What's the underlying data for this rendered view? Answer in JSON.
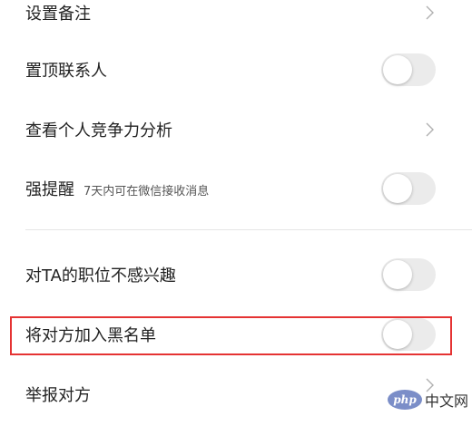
{
  "rows": {
    "remark": {
      "label": "设置备注"
    },
    "pin_contact": {
      "label": "置顶联系人",
      "toggle_on": false
    },
    "competitiveness": {
      "label": "查看个人竞争力分析"
    },
    "strong_reminder": {
      "label": "强提醒",
      "sublabel": "7天内可在微信接收消息",
      "toggle_on": false
    },
    "not_interested": {
      "label": "对TA的职位不感兴趣",
      "toggle_on": false
    },
    "blacklist": {
      "label": "将对方加入黑名单",
      "toggle_on": false
    },
    "report": {
      "label": "举报对方"
    }
  },
  "watermark": {
    "logo_text": "php",
    "text": "中文网"
  },
  "colors": {
    "highlight_border": "#e53333",
    "toggle_off_track": "#ebebeb",
    "divider": "#e6e6e6",
    "chevron": "#b0b0b0"
  },
  "icons": {
    "chevron": "chevron-right-icon"
  }
}
